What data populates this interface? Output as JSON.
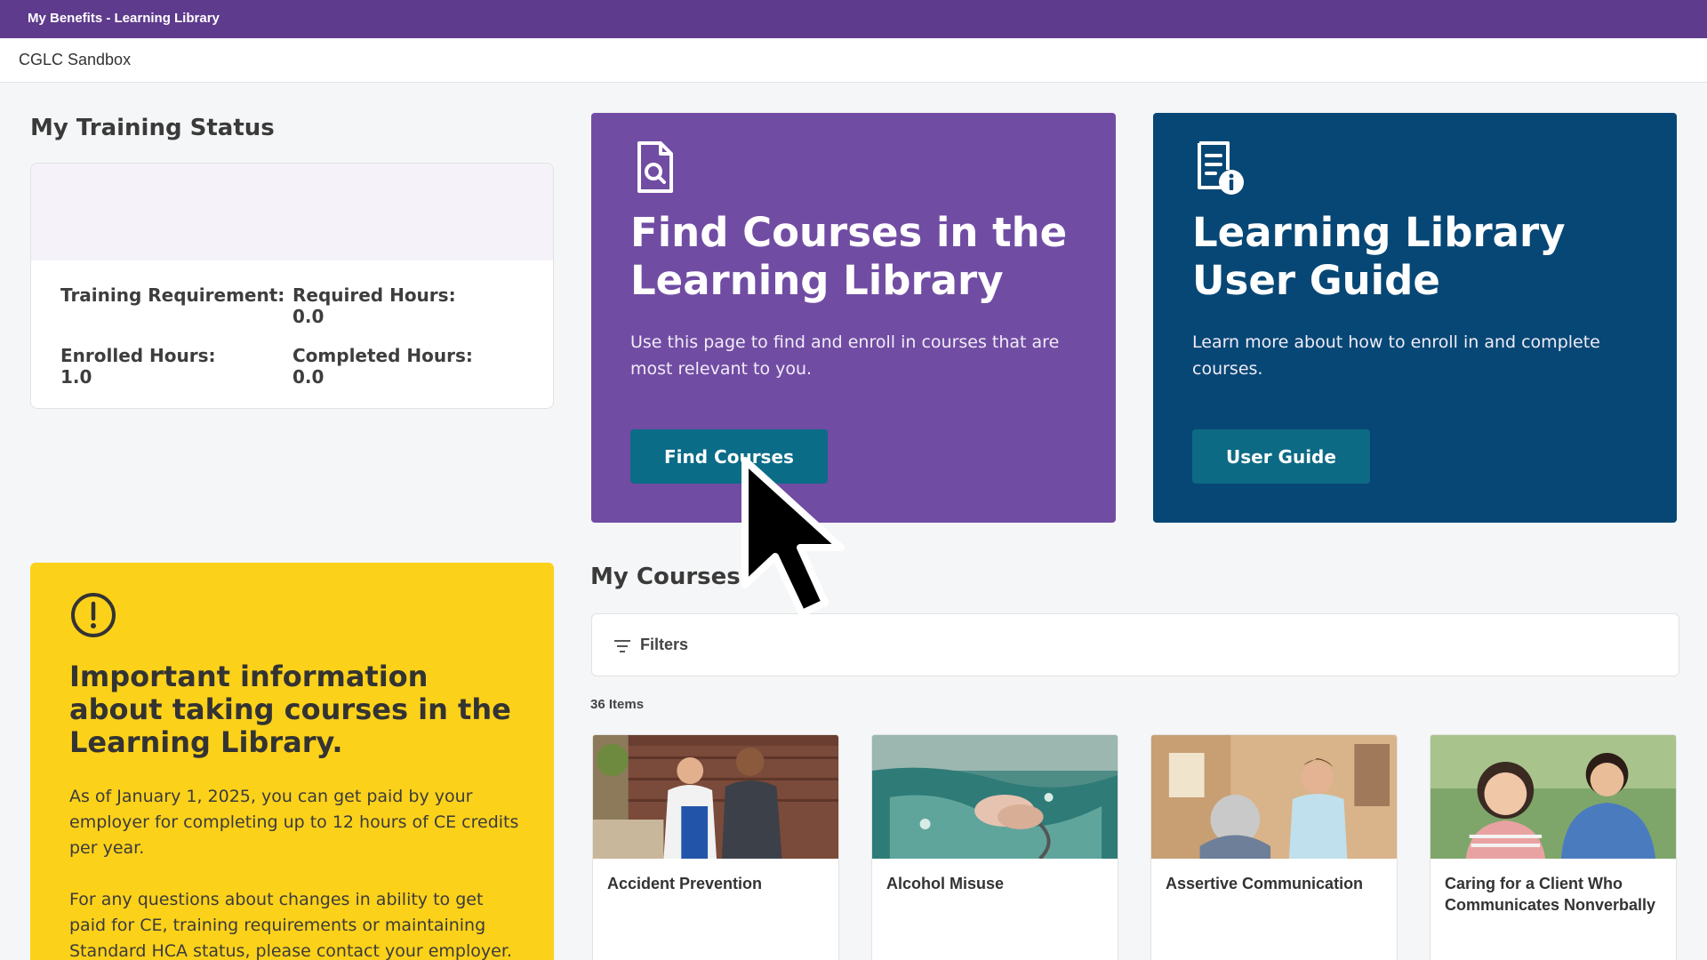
{
  "topbar": {
    "title": "My Benefits - Learning Library"
  },
  "subbar": {
    "org": "CGLC Sandbox"
  },
  "training_status": {
    "heading": "My Training Status",
    "requirement_label": "Training Requirement:",
    "required_label": "Required Hours:",
    "required_value": "0.0",
    "enrolled_label": "Enrolled Hours:",
    "enrolled_value": "1.0",
    "completed_label": "Completed Hours:",
    "completed_value": "0.0"
  },
  "find_card": {
    "icon": "document-search-icon",
    "title": "Find Courses in the Learning Library",
    "description": "Use this page to find and enroll in courses that are most relevant to you.",
    "button": "Find Courses"
  },
  "guide_card": {
    "icon": "document-info-icon",
    "title": "Learning Library User Guide",
    "description": "Learn more about how to enroll in and complete courses.",
    "button": "User Guide"
  },
  "info_card": {
    "icon": "alert-circle-icon",
    "title": "Important information about taking courses in the Learning Library.",
    "p1": "As of January 1, 2025, you can get paid by your employer for completing up to 12 hours of CE credits per year.",
    "p2": "For any questions about changes in ability to get paid for CE, training requirements or maintaining Standard HCA status, please contact your employer."
  },
  "my_courses": {
    "heading": "My Courses",
    "filters_label": "Filters",
    "items_count": "36 Items",
    "courses": [
      {
        "name": "Accident Prevention"
      },
      {
        "name": "Alcohol Misuse"
      },
      {
        "name": "Assertive Communication"
      },
      {
        "name": "Caring for a Client Who Communicates Nonverbally"
      }
    ]
  },
  "colors": {
    "topbar": "#5e3b8c",
    "find_card": "#714ca3",
    "guide_card": "#074775",
    "button": "#0a6c87",
    "info_card": "#fcd11a"
  }
}
